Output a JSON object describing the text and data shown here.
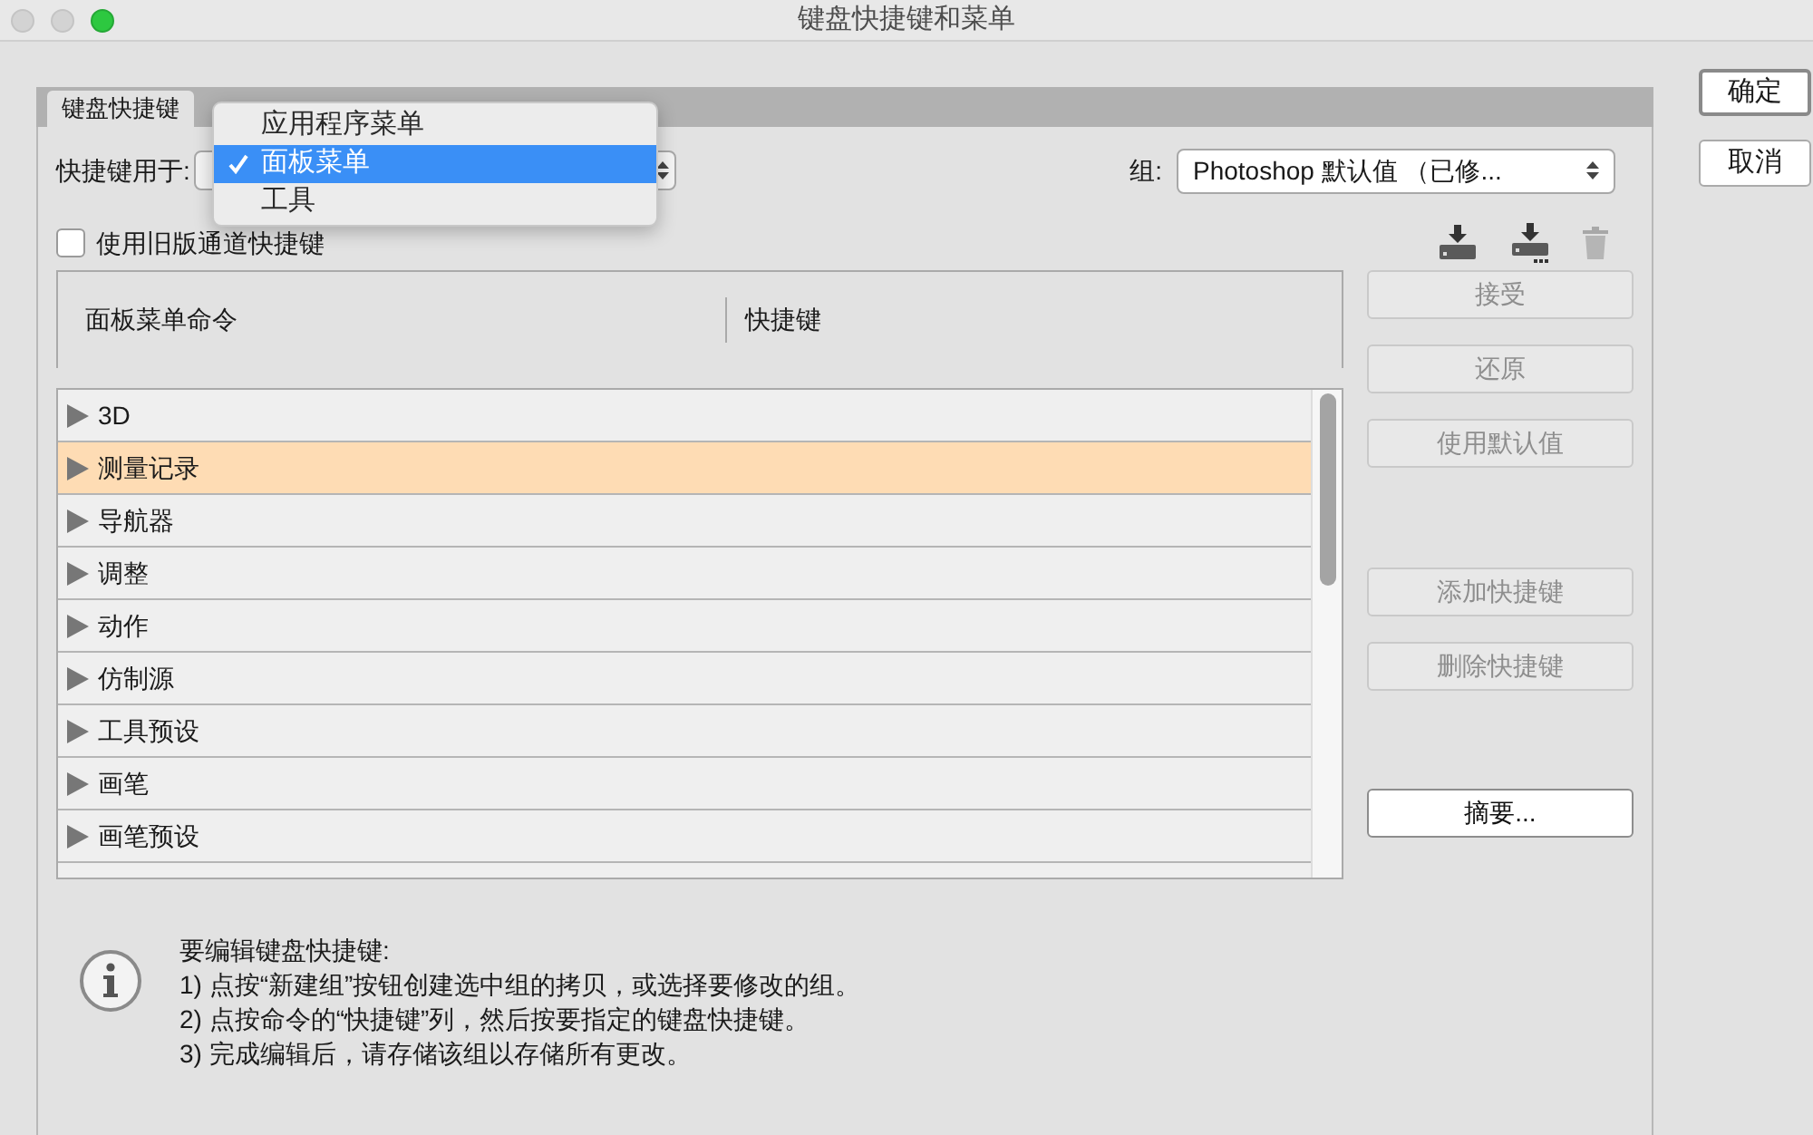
{
  "window": {
    "title": "键盘快捷键和菜单"
  },
  "tabs": [
    {
      "label": "键盘快捷键",
      "selected": true
    }
  ],
  "shortcuts_for": {
    "label": "快捷键用于:",
    "menu": [
      {
        "label": "应用程序菜单",
        "selected": false
      },
      {
        "label": "面板菜单",
        "selected": true
      },
      {
        "label": "工具",
        "selected": false
      }
    ]
  },
  "set": {
    "label": "组:",
    "value": "Photoshop 默认值 （已修..."
  },
  "legacy_checkbox": {
    "label": "使用旧版通道快捷键",
    "checked": false
  },
  "table": {
    "columns": [
      "面板菜单命令",
      "快捷键"
    ],
    "rows": [
      {
        "label": "3D",
        "selected": false
      },
      {
        "label": "测量记录",
        "selected": true
      },
      {
        "label": "导航器",
        "selected": false
      },
      {
        "label": "调整",
        "selected": false
      },
      {
        "label": "动作",
        "selected": false
      },
      {
        "label": "仿制源",
        "selected": false
      },
      {
        "label": "工具预设",
        "selected": false
      },
      {
        "label": "画笔",
        "selected": false
      },
      {
        "label": "画笔预设",
        "selected": false
      }
    ]
  },
  "side_buttons": [
    {
      "label": "接受",
      "disabled": true
    },
    {
      "label": "还原",
      "disabled": true
    },
    {
      "label": "使用默认值",
      "disabled": true
    },
    {
      "label": "添加快捷键",
      "disabled": true
    },
    {
      "label": "删除快捷键",
      "disabled": true
    },
    {
      "label": "摘要...",
      "disabled": false
    }
  ],
  "dialog_buttons": [
    "确定",
    "取消"
  ],
  "info": {
    "lines": [
      "要编辑键盘快捷键:",
      "1) 点按“新建组”按钮创建选中组的拷贝，或选择要修改的组。",
      "2) 点按命令的“快捷键”列，然后按要指定的键盘快捷键。",
      "3) 完成编辑后，请存储该组以存储所有更改。"
    ]
  }
}
